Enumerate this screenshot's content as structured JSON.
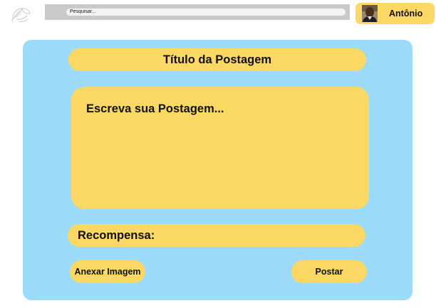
{
  "header": {
    "logo_icon": "leaf-logo-icon",
    "search": {
      "placeholder": "Pesquisar...",
      "value": ""
    },
    "user": {
      "name": "Antônio",
      "avatar_icon": "user-avatar"
    }
  },
  "post_form": {
    "title_placeholder": "Título da Postagem",
    "body_placeholder": "Escreva sua Postagem...",
    "reward_label": "Recompensa:",
    "attach_button_label": "Anexar Imagem",
    "post_button_label": "Postar"
  },
  "colors": {
    "accent": "#fbd864",
    "panel": "#9cdcfa",
    "search_bar": "#c9c9c9"
  }
}
